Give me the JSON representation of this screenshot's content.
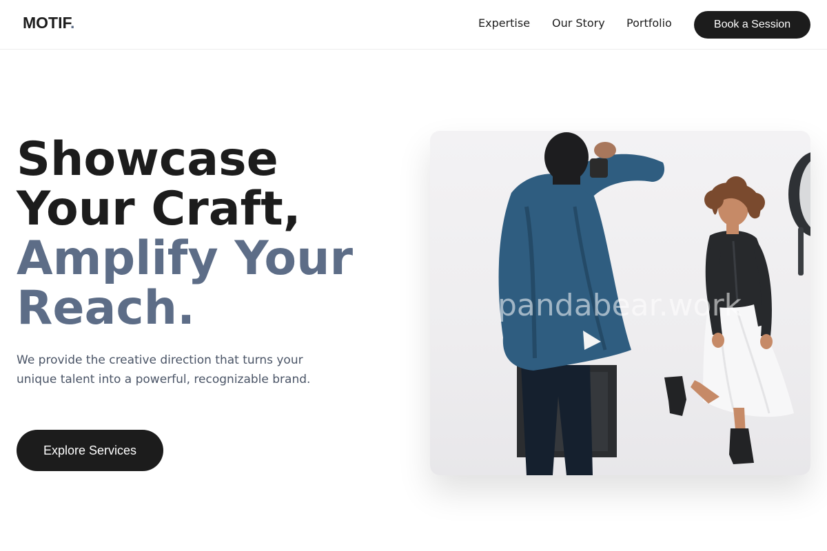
{
  "header": {
    "logo_text": "MOTIF",
    "logo_dot": ".",
    "nav": [
      {
        "label": "Expertise"
      },
      {
        "label": "Our Story"
      },
      {
        "label": "Portfolio"
      }
    ],
    "cta_label": "Book a Session"
  },
  "hero": {
    "headline_line1": "Showcase",
    "headline_line2": "Your Craft,",
    "headline_line3": "Amplify Your",
    "headline_line4": "Reach.",
    "subtext": "We provide the creative direction that turns your unique talent into a powerful, recognizable brand.",
    "cta_label": "Explore Services",
    "image_watermark": "pandabear.work"
  },
  "colors": {
    "primary": "#1c1c1c",
    "accent": "#5d6d87",
    "body_text": "#4a5466"
  }
}
